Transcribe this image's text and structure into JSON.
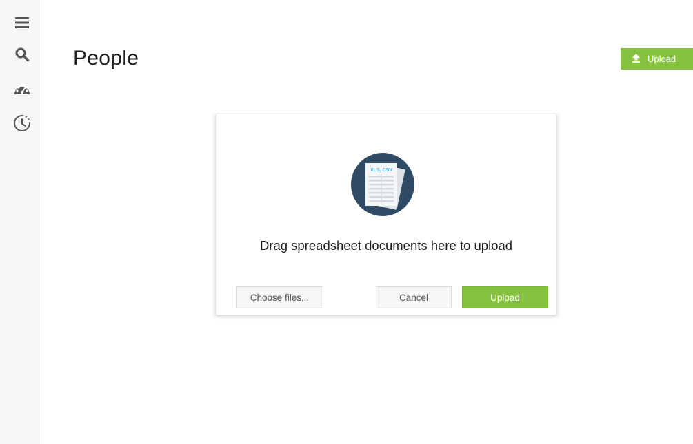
{
  "sidebar": {
    "items": [
      {
        "icon": "menu-icon"
      },
      {
        "icon": "search-icon"
      },
      {
        "icon": "dashboard-icon"
      },
      {
        "icon": "history-icon"
      }
    ]
  },
  "header": {
    "title": "People",
    "upload_label": "Upload",
    "upload_icon": "upload-icon"
  },
  "dialog": {
    "file_types_label": "XLS, CSV",
    "drop_text": "Drag spreadsheet documents here to upload",
    "choose_files_label": "Choose files...",
    "cancel_label": "Cancel",
    "upload_label": "Upload"
  },
  "colors": {
    "accent_green": "#86c240",
    "icon_dark": "#2f4a63",
    "sidebar_icon": "#555555"
  }
}
